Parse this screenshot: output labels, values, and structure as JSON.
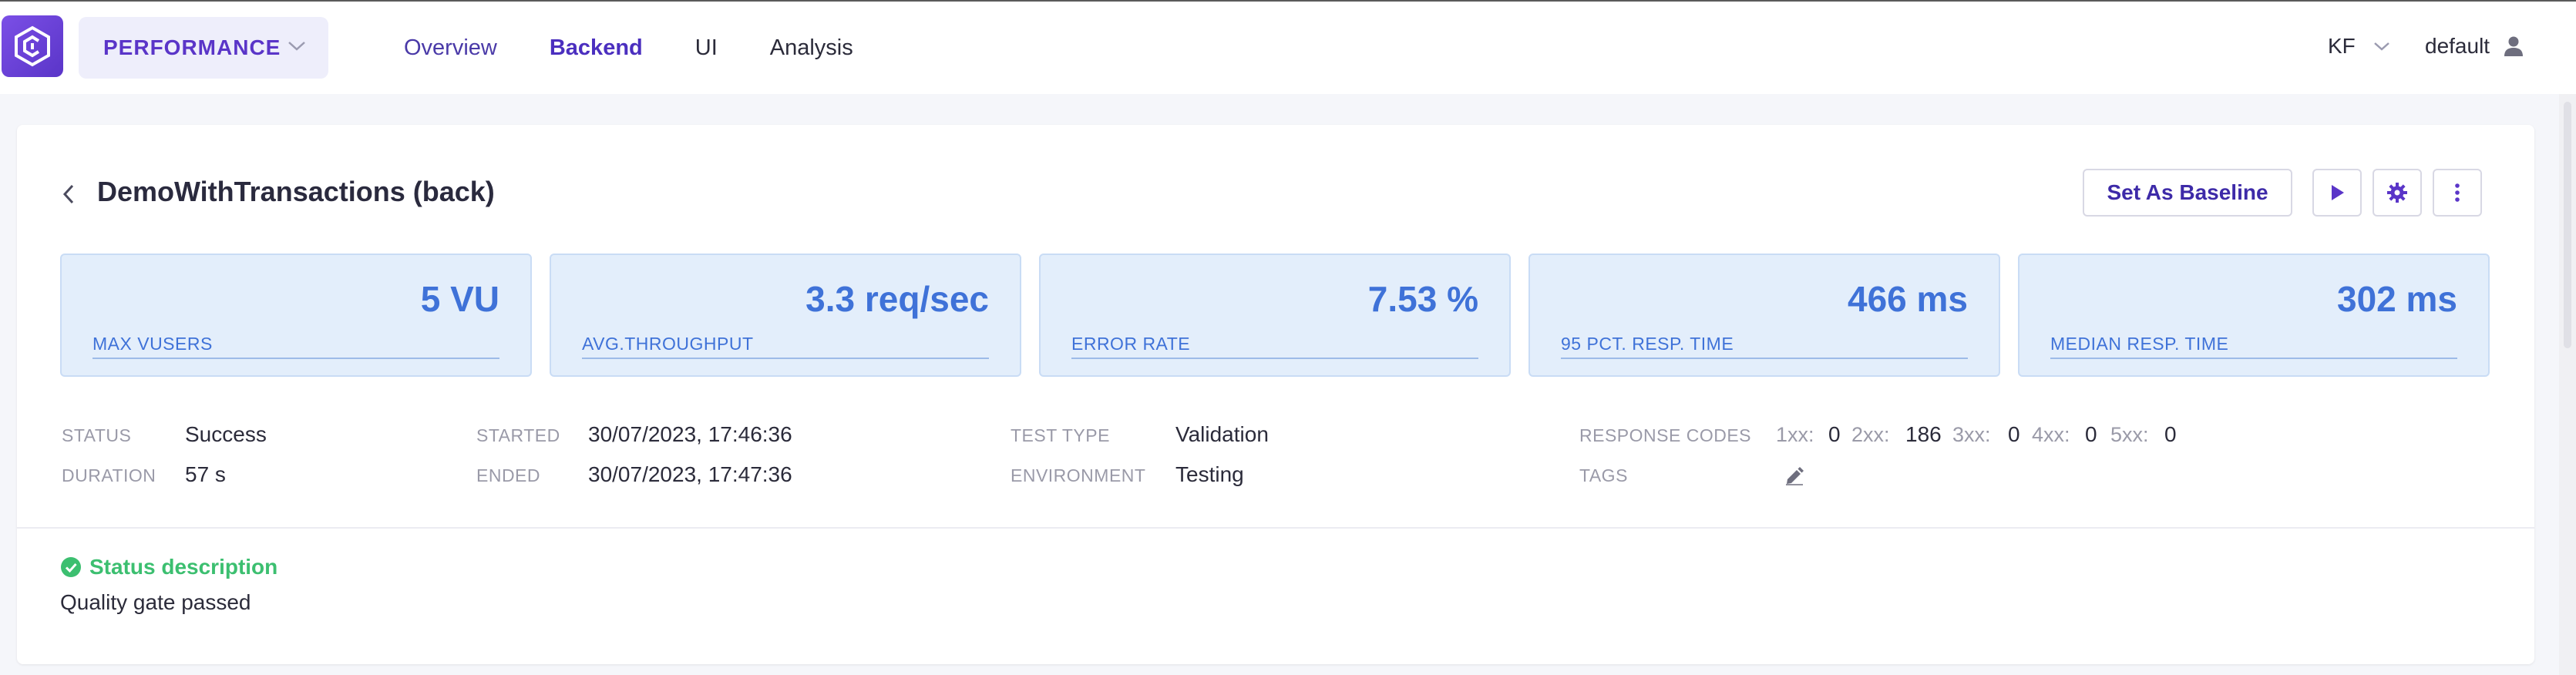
{
  "header": {
    "project_label": "PERFORMANCE",
    "nav": [
      {
        "label": "Overview"
      },
      {
        "label": "Backend"
      },
      {
        "label": "UI"
      },
      {
        "label": "Analysis"
      }
    ],
    "user_initials": "KF",
    "workspace": "default",
    "accent_color": "#5a35c8"
  },
  "test": {
    "title": "DemoWithTransactions (back)",
    "set_baseline_label": "Set As Baseline"
  },
  "stats": [
    {
      "value": "5 VU",
      "label": "MAX VUSERS"
    },
    {
      "value": "3.3 req/sec",
      "label": "AVG.THROUGHPUT"
    },
    {
      "value": "7.53 %",
      "label": "ERROR RATE"
    },
    {
      "value": "466 ms",
      "label": "95 PCT. RESP. TIME"
    },
    {
      "value": "302 ms",
      "label": "MEDIAN RESP. TIME"
    }
  ],
  "meta": {
    "status_label": "STATUS",
    "status": "Success",
    "duration_label": "DURATION",
    "duration": "57 s",
    "started_label": "STARTED",
    "started": "30/07/2023, 17:46:36",
    "ended_label": "ENDED",
    "ended": "30/07/2023, 17:47:36",
    "test_type_label": "TEST TYPE",
    "test_type": "Validation",
    "environment_label": "ENVIRONMENT",
    "environment": "Testing",
    "response_codes_label": "RESPONSE CODES",
    "tags_label": "TAGS",
    "response_codes": [
      {
        "code": "1xx:",
        "count": "0"
      },
      {
        "code": "2xx:",
        "count": "186"
      },
      {
        "code": "3xx:",
        "count": "0"
      },
      {
        "code": "4xx:",
        "count": "0"
      },
      {
        "code": "5xx:",
        "count": "0"
      }
    ]
  },
  "status_description": {
    "title": "Status description",
    "text": "Quality gate passed",
    "color": "#3cbf70"
  }
}
